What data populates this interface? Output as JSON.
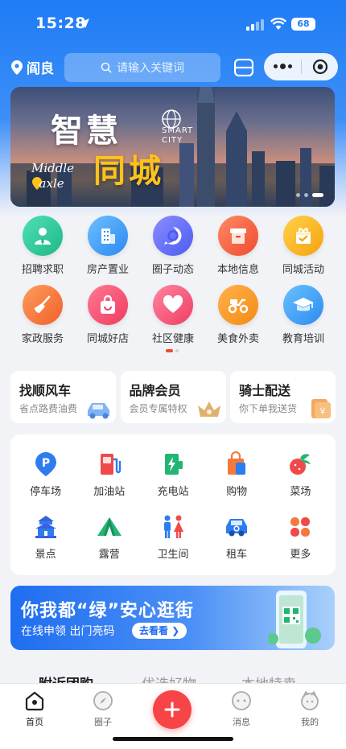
{
  "status_bar": {
    "time": "15:28",
    "battery": "68"
  },
  "header": {
    "city": "阎良",
    "search_placeholder": "请输入关键词"
  },
  "banner": {
    "title_line1": "智慧",
    "title_line2": "同城",
    "smart_label": "SMART",
    "city_label": "CITY",
    "tag_line1": "Middle",
    "tag_line2": "axle"
  },
  "grid": {
    "row1": [
      {
        "label": "招聘求职",
        "icon": "user-tie-icon",
        "color": "#27c79b"
      },
      {
        "label": "房产置业",
        "icon": "building-icon",
        "color": "#3b9cf5"
      },
      {
        "label": "圈子动态",
        "icon": "circle-chat-icon",
        "color": "#5c6cf5"
      },
      {
        "label": "本地信息",
        "icon": "box-icon",
        "color": "#f5613d"
      },
      {
        "label": "同城活动",
        "icon": "gift-icon",
        "color": "#f9b21c"
      }
    ],
    "row2": [
      {
        "label": "家政服务",
        "icon": "broom-icon",
        "color": "#f5732f"
      },
      {
        "label": "同城好店",
        "icon": "shopping-bag-icon",
        "color": "#f7496c"
      },
      {
        "label": "社区健康",
        "icon": "heart-icon",
        "color": "#f74f73"
      },
      {
        "label": "美食外卖",
        "icon": "scooter-icon",
        "color": "#f9922a"
      },
      {
        "label": "教育培训",
        "icon": "graduation-cap-icon",
        "color": "#3a9bf2"
      }
    ]
  },
  "cards": [
    {
      "title": "找顺风车",
      "subtitle": "省点路费油费",
      "icon": "car-icon"
    },
    {
      "title": "品牌会员",
      "subtitle": "会员专属特权",
      "icon": "crown-icon"
    },
    {
      "title": "骑士配送",
      "subtitle": "你下单我送货",
      "icon": "coupon-icon"
    }
  ],
  "services": {
    "row1": [
      {
        "label": "停车场",
        "icon": "parking-icon"
      },
      {
        "label": "加油站",
        "icon": "gas-station-icon"
      },
      {
        "label": "充电站",
        "icon": "charging-station-icon"
      },
      {
        "label": "购物",
        "icon": "shopping-icon"
      },
      {
        "label": "菜场",
        "icon": "vegetable-icon"
      }
    ],
    "row2": [
      {
        "label": "景点",
        "icon": "temple-icon"
      },
      {
        "label": "露营",
        "icon": "tent-icon"
      },
      {
        "label": "卫生间",
        "icon": "toilet-icon"
      },
      {
        "label": "租车",
        "icon": "rental-car-icon"
      },
      {
        "label": "更多",
        "icon": "more-grid-icon"
      }
    ]
  },
  "promo": {
    "headline": "你我都“绿”安心逛街",
    "subline": "在线申领 出门亮码",
    "button": "去看看 ❯"
  },
  "feed_tabs": [
    "附近团购",
    "优选好物",
    "本地特卖"
  ],
  "tabbar": {
    "home": "首页",
    "circle": "圈子",
    "messages": "消息",
    "mine": "我的"
  },
  "colors": {
    "primary": "#1e7cf5",
    "accent_red": "#f74447"
  }
}
